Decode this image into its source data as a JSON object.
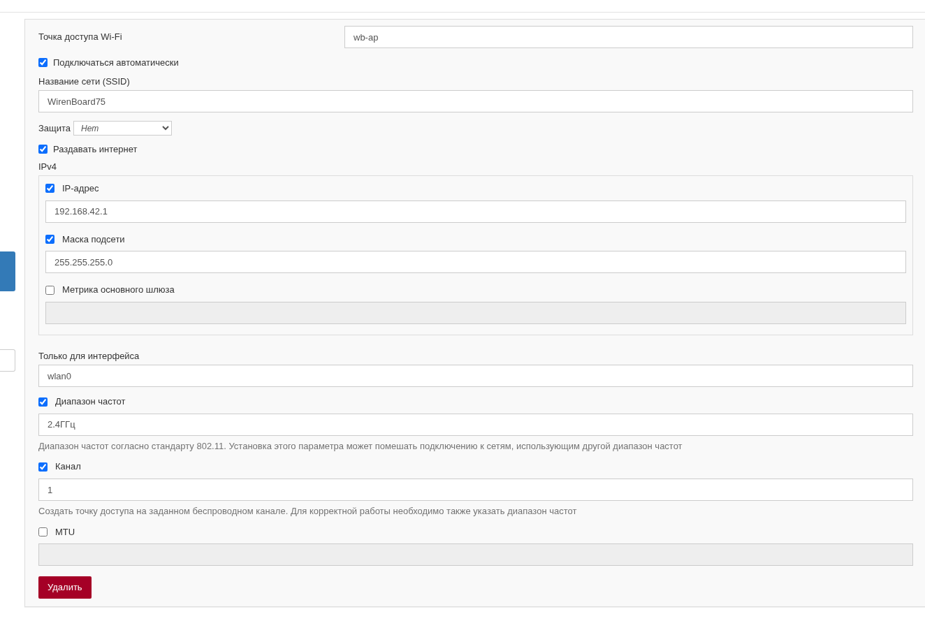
{
  "form": [
    {
      "kind": "text_row",
      "label": "Точка доступа Wi-Fi",
      "value": "wb-ap"
    },
    {
      "kind": "checkbox",
      "label": "Подключаться автоматически",
      "checked": true
    },
    {
      "kind": "text",
      "label": "Название сети (SSID)",
      "value": "WirenBoard75"
    },
    {
      "kind": "select",
      "label": "Защита",
      "value": "Нет"
    },
    {
      "kind": "checkbox",
      "label": "Раздавать интернет",
      "checked": true
    },
    {
      "kind": "group",
      "label": "IPv4",
      "fields": [
        {
          "kind": "optional",
          "label": "IP-адрес",
          "checked": true,
          "value": "192.168.42.1"
        },
        {
          "kind": "optional",
          "label": "Маска подсети",
          "checked": true,
          "value": "255.255.255.0"
        },
        {
          "kind": "optional",
          "label": "Метрика основного шлюза",
          "checked": false
        }
      ]
    },
    {
      "kind": "text",
      "label": "Только для интерфейса",
      "value": "wlan0"
    },
    {
      "kind": "optional",
      "label": "Диапазон частот",
      "checked": true,
      "value": "2.4ГГц",
      "help": "Диапазон частот согласно стандарту 802.11. Установка этого параметра может помешать подключению к сетям, использующим другой диапазон частот"
    },
    {
      "kind": "optional",
      "label": "Канал",
      "checked": true,
      "value": "1",
      "help": "Создать точку доступа на заданном беспроводном канале. Для корректной работы необходимо также указать диапазон частот"
    },
    {
      "kind": "optional",
      "label": "MTU",
      "checked": false
    }
  ],
  "delete_button": "Удалить"
}
